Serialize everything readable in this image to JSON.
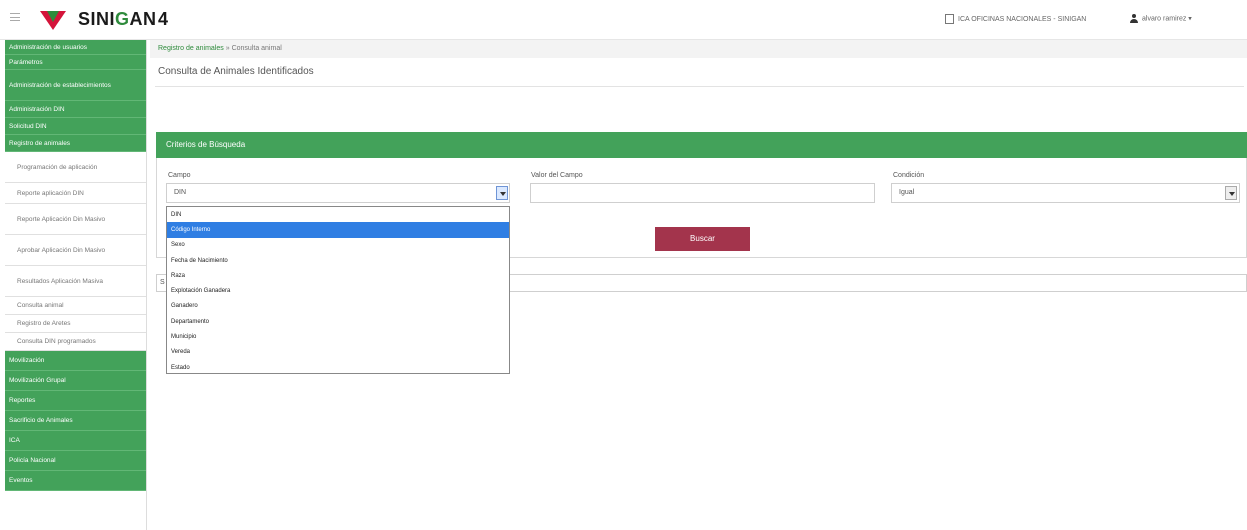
{
  "header": {
    "brand_prefix": "SINI",
    "brand_highlight": "G",
    "brand_suffix": "AN",
    "version": "4",
    "office": "ICA OFICINAS NACIONALES - SINIGAN",
    "user": "alvaro ramirez",
    "colors": {
      "brand_green": "#2e8b3c",
      "brand_red": "#d4143a"
    }
  },
  "sidebar": {
    "items_top": [
      "Administración de usuarios",
      "Parámetros",
      "Administración de establecimientos",
      "Administración DIN",
      "Solicitud DIN",
      "Registro de animales"
    ],
    "sub_items": [
      "Programación de aplicación",
      "Reporte aplicación DIN",
      "Reporte Aplicación Din Masivo",
      "Aprobar Aplicación Din Masivo",
      "Resultados Aplicación Masiva",
      "Consulta animal",
      "Registro de Aretes",
      "Consulta DIN programados"
    ],
    "items_bottom": [
      "Movilización",
      "Movilización Grupal",
      "Reportes",
      "Sacrificio de Animales",
      "ICA",
      "Policía Nacional",
      "Eventos"
    ]
  },
  "breadcrumb": {
    "parent": "Registro de animales",
    "separator": "»",
    "current": "Consulta animal"
  },
  "page": {
    "title": "Consulta de Animales Identificados"
  },
  "search_panel": {
    "header": "Criterios de Búsqueda",
    "campo_label": "Campo",
    "campo_value": "DIN",
    "valor_label": "Valor del Campo",
    "valor_value": "",
    "condicion_label": "Condición",
    "condicion_value": "Igual",
    "search_button": "Buscar"
  },
  "results": {
    "label": "S"
  },
  "dropdown": {
    "options": [
      "DIN",
      "Código Interno",
      "Sexo",
      "Fecha de Nacimiento",
      "Raza",
      "Explotación Ganadera",
      "Ganadero",
      "Departamento",
      "Municipio",
      "Vereda",
      "Estado"
    ],
    "highlighted_index": 1
  }
}
